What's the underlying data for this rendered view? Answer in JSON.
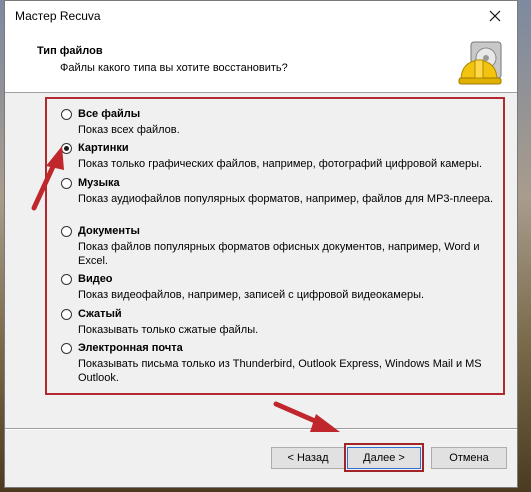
{
  "window": {
    "title": "Мастер Recuva"
  },
  "header": {
    "title": "Тип файлов",
    "subtitle": "Файлы какого типа вы хотите восстановить?"
  },
  "options": [
    {
      "label": "Все файлы",
      "desc": "Показ всех файлов.",
      "checked": false
    },
    {
      "label": "Картинки",
      "desc": "Показ только графических файлов, например, фотографий цифровой камеры.",
      "checked": true
    },
    {
      "label": "Музыка",
      "desc": "Показ аудиофайлов популярных форматов, например, файлов для MP3-плеера.",
      "checked": false
    },
    {
      "label": "Документы",
      "desc": "Показ файлов популярных форматов офисных документов, например, Word и Excel.",
      "checked": false
    },
    {
      "label": "Видео",
      "desc": "Показ видеофайлов, например, записей с цифровой видеокамеры.",
      "checked": false
    },
    {
      "label": "Сжатый",
      "desc": "Показывать только сжатые файлы.",
      "checked": false
    },
    {
      "label": "Электронная почта",
      "desc": "Показывать письма только из Thunderbird, Outlook Express, Windows Mail и MS Outlook.",
      "checked": false
    }
  ],
  "buttons": {
    "back": "< Назад",
    "next": "Далее >",
    "cancel": "Отмена"
  },
  "colors": {
    "highlight": "#b02a30",
    "arrow": "#c0272d"
  }
}
